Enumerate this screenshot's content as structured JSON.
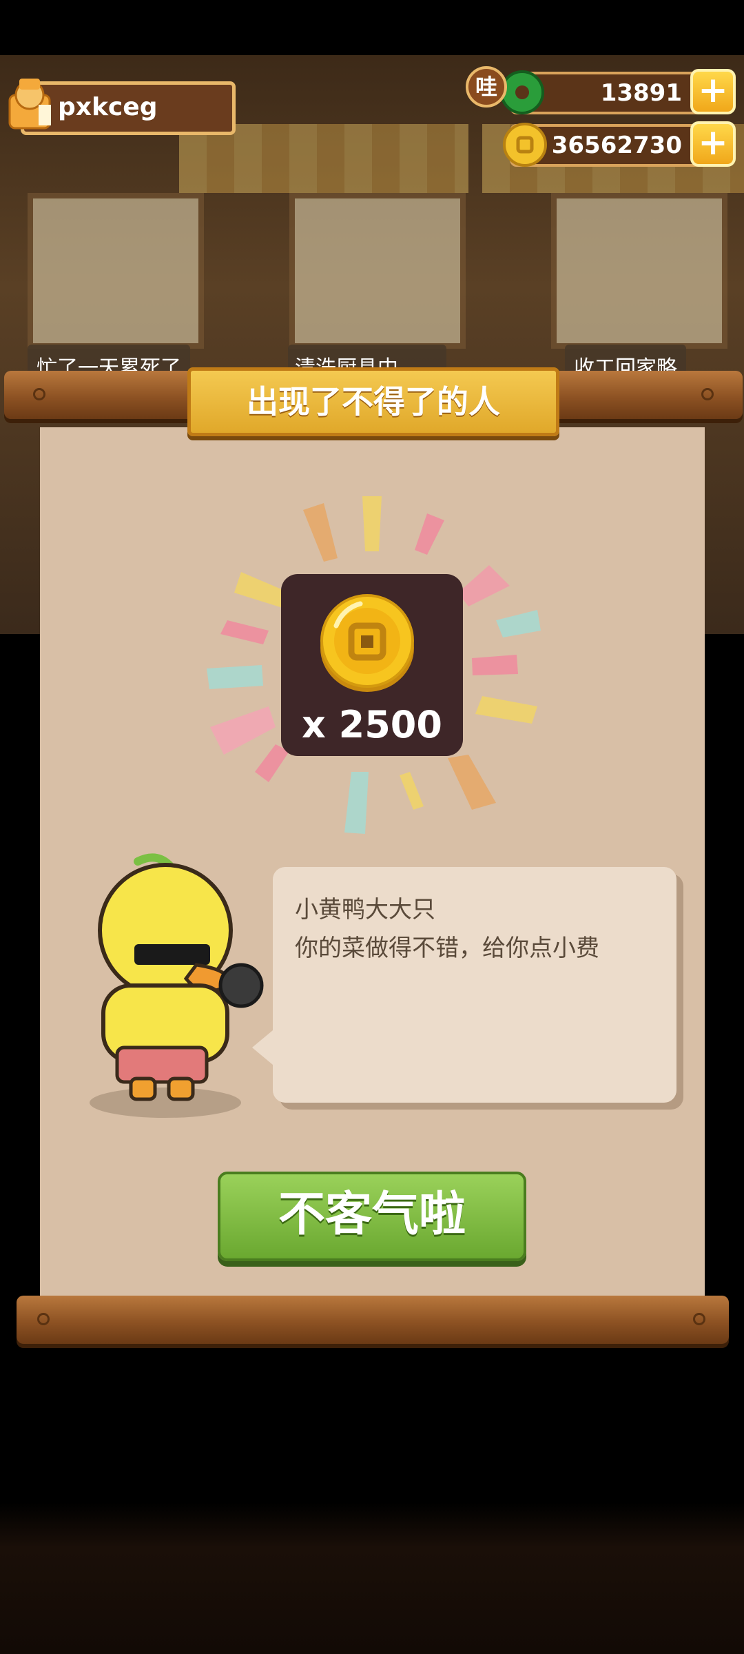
{
  "colors": {
    "primary": "#e0a82a",
    "button": "#6aa830",
    "paper": "#d8bfa6"
  },
  "header": {
    "username": "pxkceg",
    "jade_amount": "13891",
    "jade_badge": "哇",
    "coin_amount": "36562730",
    "plus": "+"
  },
  "background": {
    "bubbles": [
      "忙了一天累死了",
      "清洗厨具中……",
      "收工回家略"
    ]
  },
  "dialog": {
    "title": "出现了不得了的人",
    "reward_text": "x 2500",
    "reward_icon": "copper-coin-icon",
    "speaker": "小黄鸭大大只",
    "message": "你的菜做得不错，给你点小费",
    "confirm_label": "不客气啦"
  }
}
